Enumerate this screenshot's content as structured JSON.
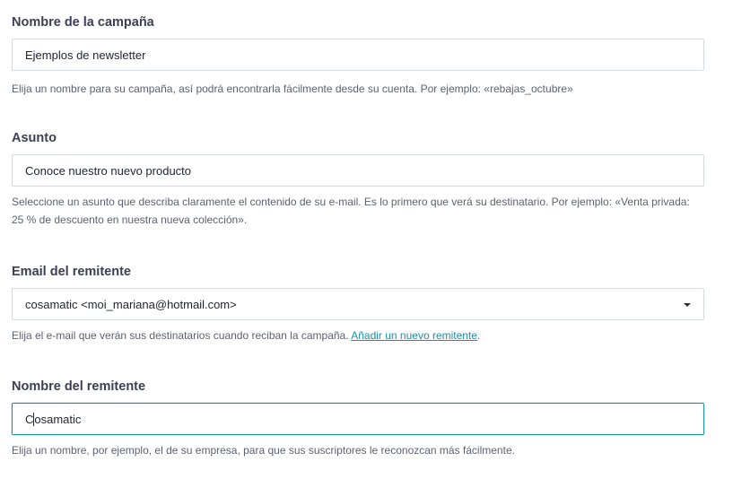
{
  "campaign_name": {
    "label": "Nombre de la campaña",
    "value": "Ejemplos de newsletter",
    "help": "Elija un nombre para su campaña, así podrá encontrarla fácilmente desde su cuenta. Por ejemplo: «rebajas_octubre»"
  },
  "subject": {
    "label": "Asunto",
    "value": "Conoce nuestro nuevo producto",
    "help": "Seleccione un asunto que describa claramente el contenido de su e-mail. Es lo primero que verá su destinatario. Por ejemplo: «Venta privada: 25 % de descuento en nuestra nueva colección»."
  },
  "sender_email": {
    "label": "Email del remitente",
    "selected": "cosamatic <moi_mariana@hotmail.com>",
    "help_prefix": "Elija el e-mail que verán sus destinatarios cuando reciban la campaña.",
    "link_label": "Añadir un nuevo remitente",
    "help_suffix": "."
  },
  "sender_name": {
    "label": "Nombre del remitente",
    "value_before_cursor": "C",
    "value_after_cursor": "osamatic",
    "help": "Elija un nombre, por ejemplo, el de su empresa, para que sus suscriptores le reconozcan más fácilmente."
  },
  "colors": {
    "label": "#3b4052",
    "help_text": "#5a6272",
    "link": "#1f8ea6",
    "input_border": "#d2d9e0",
    "focus_border": "#1f8ea6"
  }
}
